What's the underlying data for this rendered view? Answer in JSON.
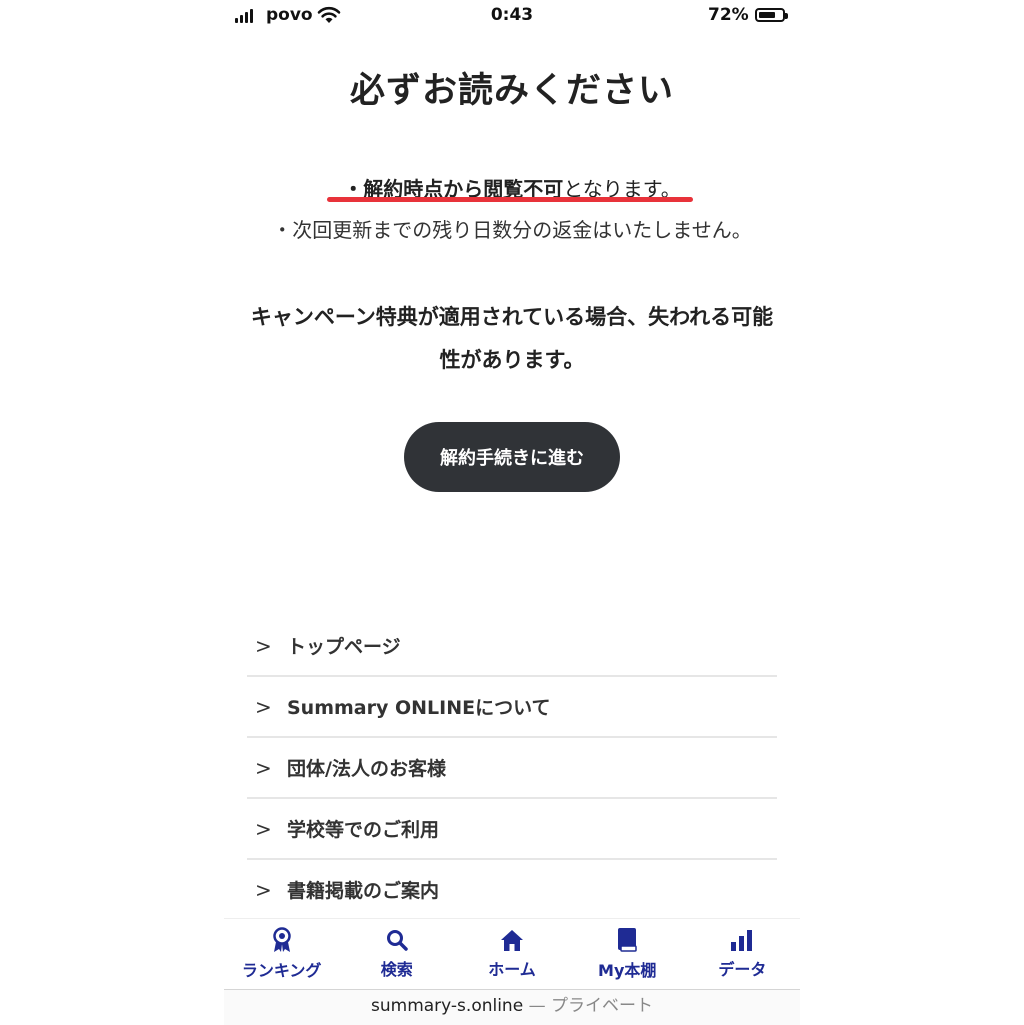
{
  "status_bar": {
    "carrier": "povo",
    "time": "0:43",
    "battery_percent": "72%",
    "battery_level": 0.72
  },
  "title": "必ずお読みください",
  "notices": {
    "line1_bold": "・解約時点から閲覧不可",
    "line1_rest": "となります。",
    "line2": "・次回更新までの残り日数分の返金はいたしません。"
  },
  "campaign_notice": "キャンペーン特典が適用されている場合、失われる可能性があります。",
  "cta_label": "解約手続きに進む",
  "menu": {
    "chevron": ">",
    "items": [
      "トップページ",
      "Summary ONLINEについて",
      "団体/法人のお客様",
      "学校等でのご利用",
      "書籍掲載のご案内"
    ]
  },
  "tabbar": [
    {
      "label": "ランキング",
      "icon": "ranking-medal-icon"
    },
    {
      "label": "検索",
      "icon": "search-icon"
    },
    {
      "label": "ホーム",
      "icon": "home-icon"
    },
    {
      "label": "My本棚",
      "icon": "book-icon"
    },
    {
      "label": "データ",
      "icon": "bar-chart-icon"
    }
  ],
  "browser": {
    "url": "summary-s.online",
    "mode": "— プライベート"
  },
  "colors": {
    "accent_underline": "#e8323a",
    "button_bg": "#303337",
    "tab_color": "#1f2b94"
  }
}
